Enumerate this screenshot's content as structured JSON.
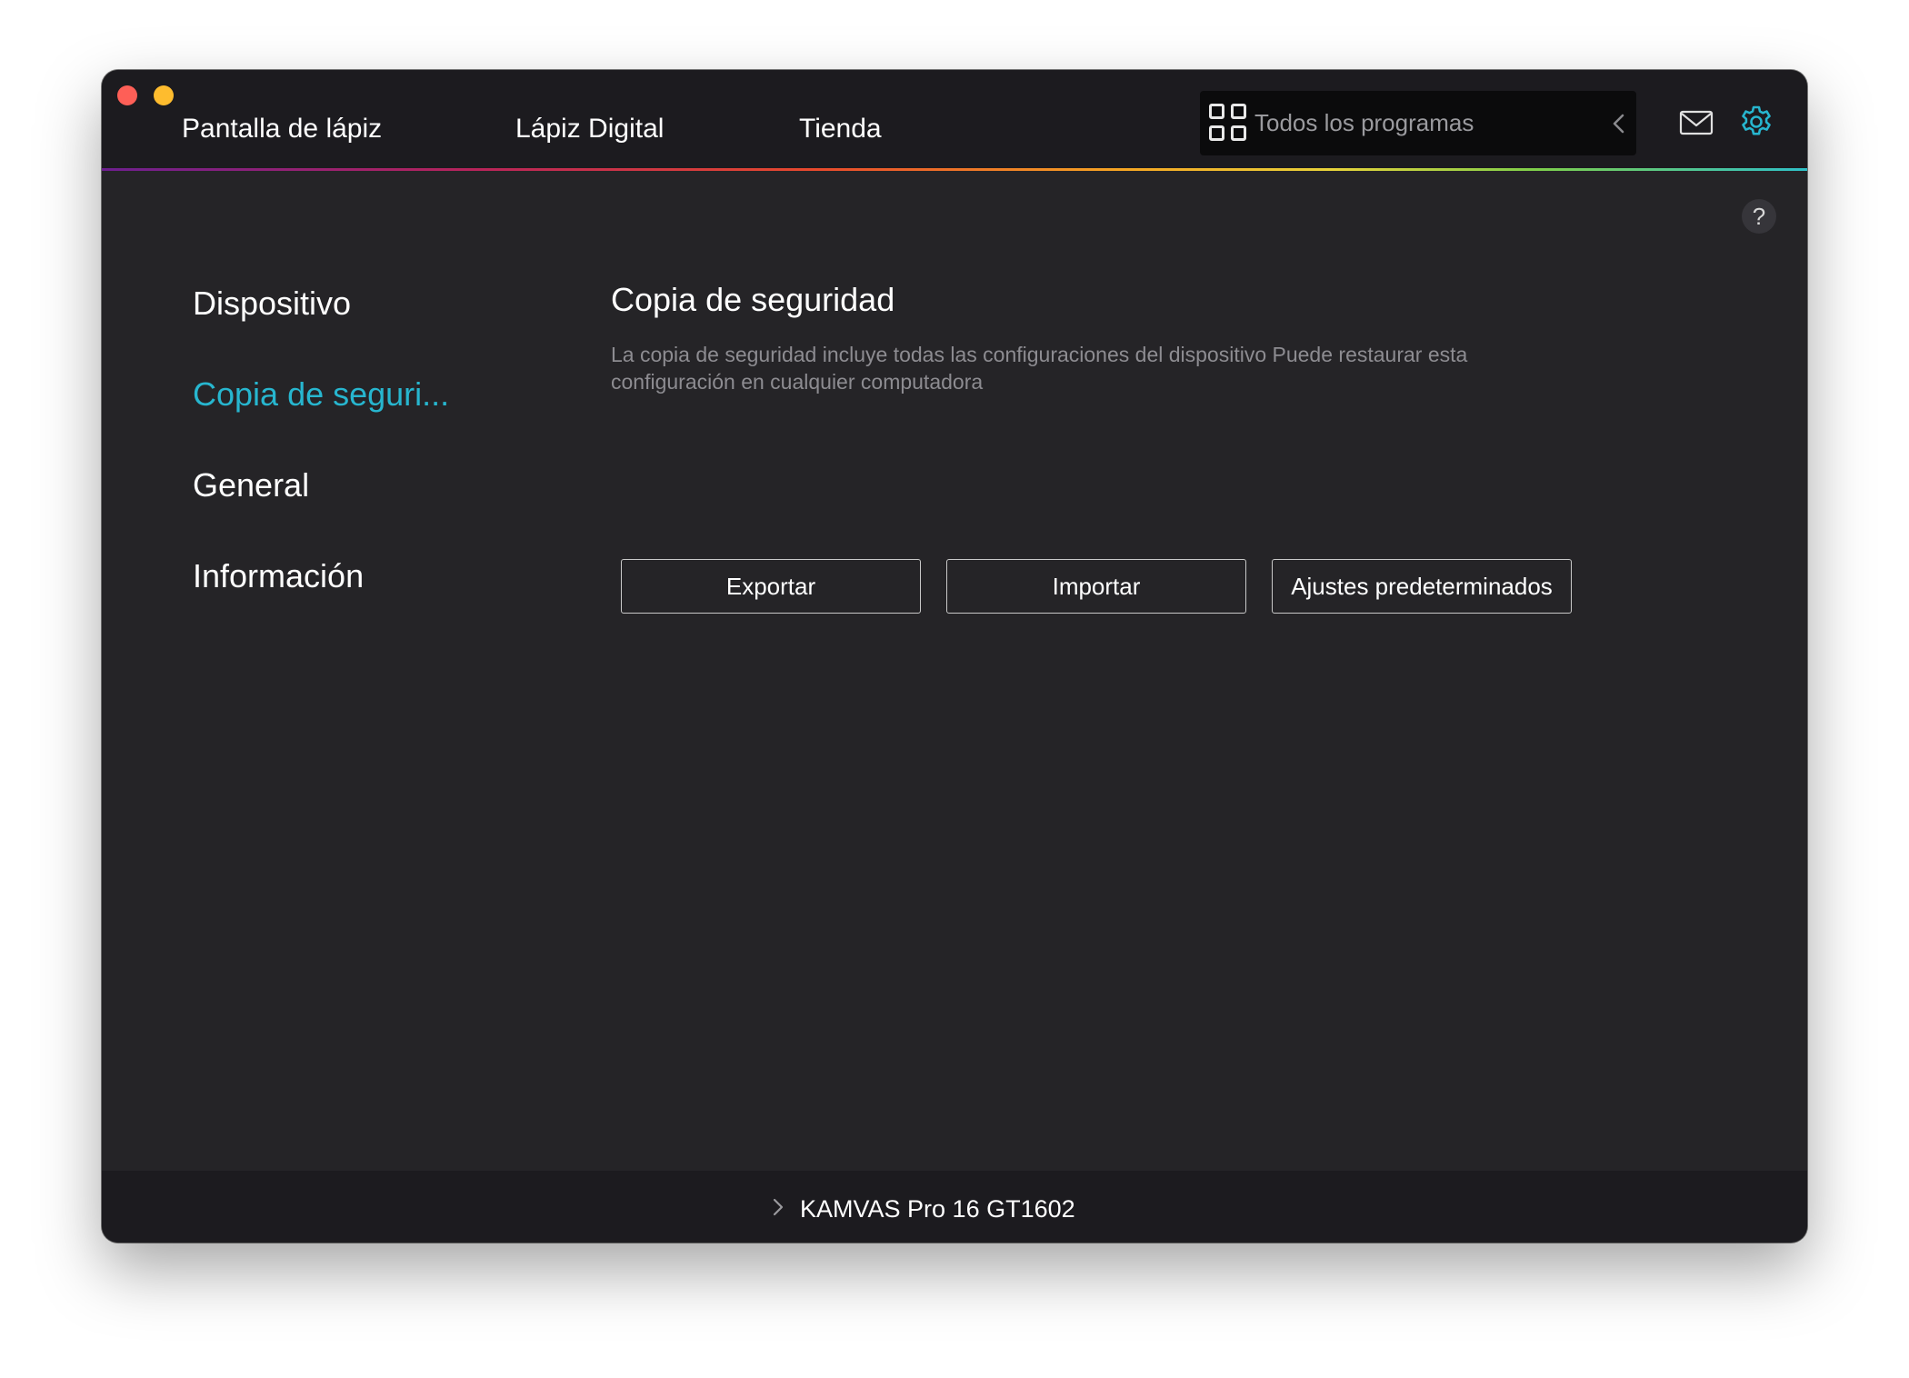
{
  "window": {
    "title_tabs": [
      {
        "label": "Pantalla de lápiz"
      },
      {
        "label": "Lápiz Digital"
      },
      {
        "label": "Tienda"
      }
    ],
    "program_selector": {
      "label": "Todos los programas",
      "icon": "grid-icon"
    },
    "header_icons": {
      "mail": "mail-icon",
      "settings": "gear-icon"
    },
    "help_label": "?"
  },
  "sidebar": {
    "items": [
      {
        "label": "Dispositivo",
        "active": false
      },
      {
        "label": "Copia de seguri...",
        "active": true
      },
      {
        "label": "General",
        "active": false
      },
      {
        "label": "Información",
        "active": false
      }
    ]
  },
  "main": {
    "title": "Copia de seguridad",
    "description": "La copia de seguridad incluye todas las configuraciones del dispositivo Puede restaurar esta configuración en cualquier computadora",
    "buttons": {
      "export_label": "Exportar",
      "import_label": "Importar",
      "defaults_label": "Ajustes predeterminados"
    }
  },
  "footer": {
    "device_name": "KAMVAS Pro 16 GT1602"
  },
  "colors": {
    "accent": "#27b6cf",
    "background": "#252427",
    "titlebar": "#1c1b1f"
  }
}
